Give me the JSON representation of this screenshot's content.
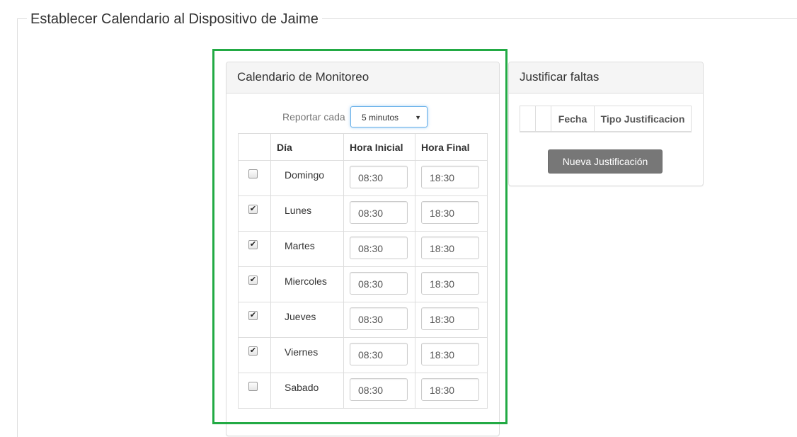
{
  "page": {
    "title": "Establecer Calendario al Dispositivo de Jaime"
  },
  "calendar_panel": {
    "title": "Calendario de Monitoreo",
    "report_label": "Reportar cada",
    "report_value": "5 minutos",
    "columns": [
      "",
      "Día",
      "Hora Inicial",
      "Hora Final"
    ],
    "rows": [
      {
        "checked": false,
        "check_mark": "",
        "day": "Domingo",
        "start": "08:30",
        "end": "18:30"
      },
      {
        "checked": true,
        "check_mark": "✔",
        "day": "Lunes",
        "start": "08:30",
        "end": "18:30"
      },
      {
        "checked": true,
        "check_mark": "✔",
        "day": "Martes",
        "start": "08:30",
        "end": "18:30"
      },
      {
        "checked": true,
        "check_mark": "✔",
        "day": "Miercoles",
        "start": "08:30",
        "end": "18:30"
      },
      {
        "checked": true,
        "check_mark": "✔",
        "day": "Jueves",
        "start": "08:30",
        "end": "18:30"
      },
      {
        "checked": true,
        "check_mark": "✔",
        "day": "Viernes",
        "start": "08:30",
        "end": "18:30"
      },
      {
        "checked": false,
        "check_mark": "",
        "day": "Sabado",
        "start": "08:30",
        "end": "18:30"
      }
    ]
  },
  "justify_panel": {
    "title": "Justificar faltas",
    "columns": [
      "",
      "",
      "Fecha",
      "Tipo Justificacion"
    ],
    "new_button": "Nueva Justificación"
  },
  "colors": {
    "highlight": "#22aa44",
    "button": "#777777",
    "focus": "#66afe9"
  }
}
